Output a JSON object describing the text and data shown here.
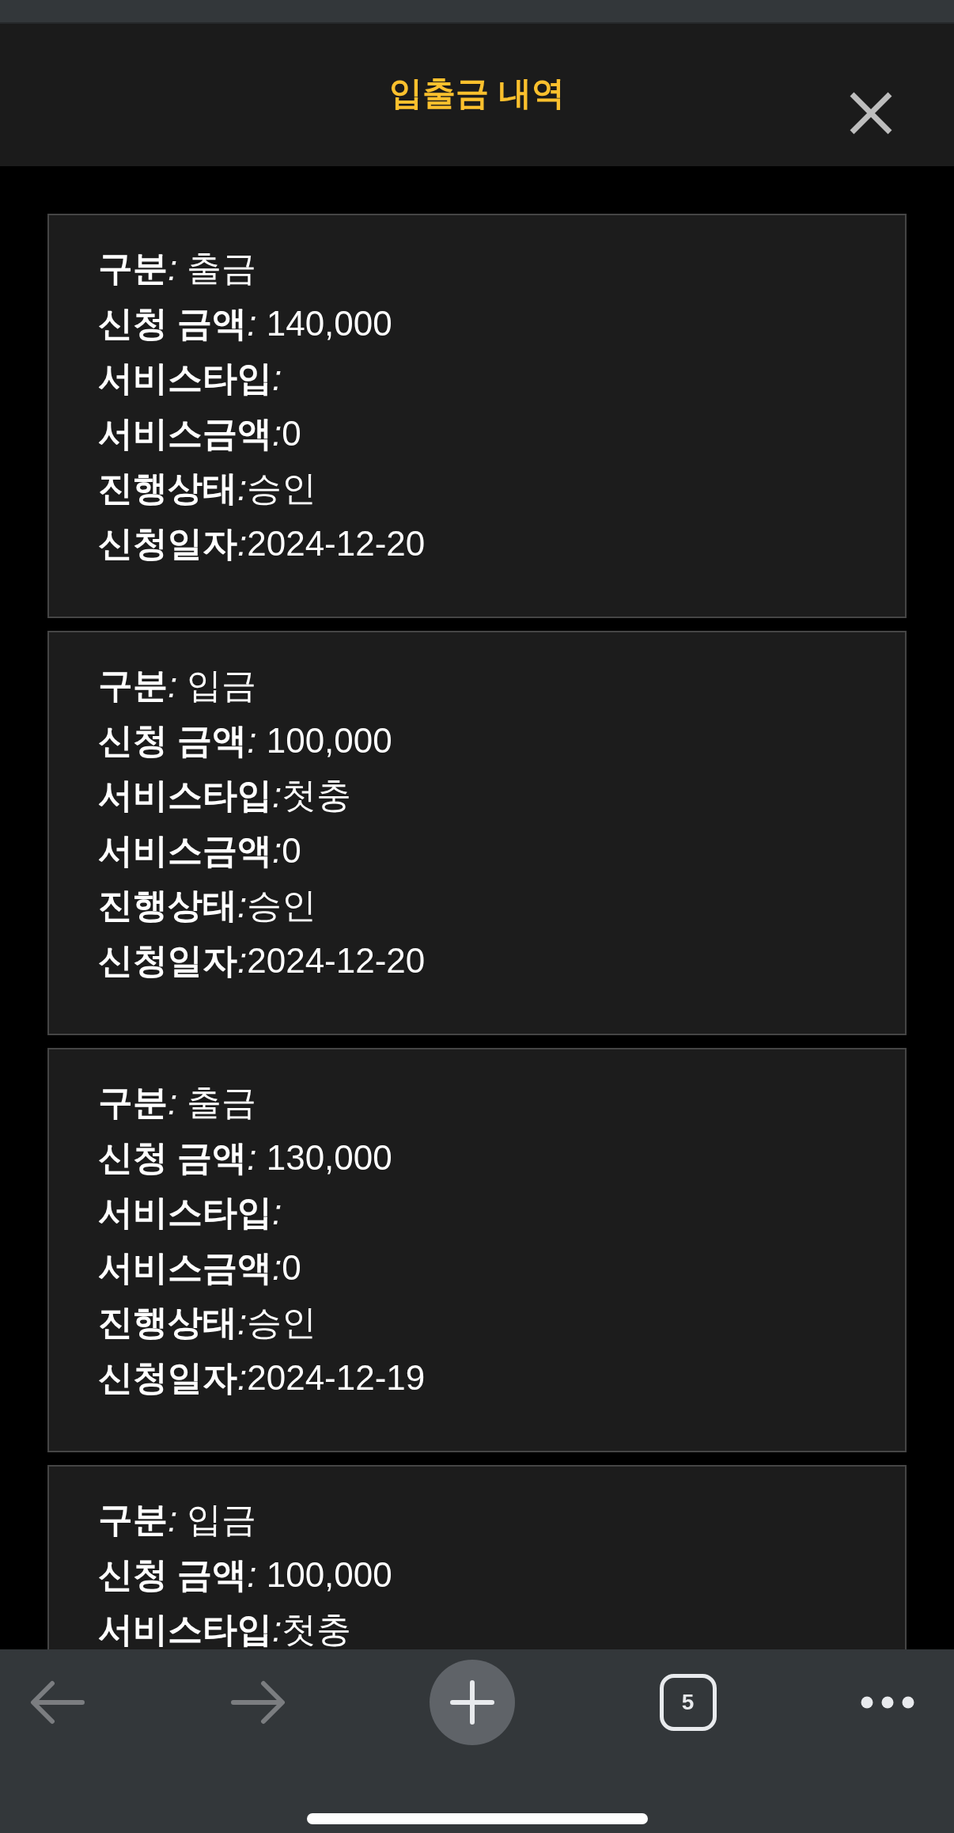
{
  "header": {
    "title": "입출금 내역"
  },
  "records": [
    {
      "lines": [
        {
          "label": "구분",
          "separator": ": ",
          "value": "출금"
        },
        {
          "label": "신청 금액",
          "separator": ": ",
          "value": "140,000"
        },
        {
          "label": "서비스타입",
          "separator": ":"
        },
        {
          "label": "서비스금액",
          "separator": ":",
          "value": "0"
        },
        {
          "label": "진행상태",
          "separator": ":",
          "value": "승인"
        },
        {
          "label": "신청일자",
          "separator": ":",
          "value": "2024-12-20"
        }
      ]
    },
    {
      "lines": [
        {
          "label": "구분",
          "separator": ": ",
          "value": "입금"
        },
        {
          "label": "신청 금액",
          "separator": ": ",
          "value": "100,000"
        },
        {
          "label": "서비스타입",
          "separator": ":",
          "value": "첫충"
        },
        {
          "label": "서비스금액",
          "separator": ":",
          "value": "0"
        },
        {
          "label": "진행상태",
          "separator": ":",
          "value": "승인"
        },
        {
          "label": "신청일자",
          "separator": ":",
          "value": "2024-12-20"
        }
      ]
    },
    {
      "lines": [
        {
          "label": "구분",
          "separator": ": ",
          "value": "출금"
        },
        {
          "label": "신청 금액",
          "separator": ": ",
          "value": "130,000"
        },
        {
          "label": "서비스타입",
          "separator": ":"
        },
        {
          "label": "서비스금액",
          "separator": ":",
          "value": "0"
        },
        {
          "label": "진행상태",
          "separator": ":",
          "value": "승인"
        },
        {
          "label": "신청일자",
          "separator": ":",
          "value": "2024-12-19"
        }
      ]
    },
    {
      "lines": [
        {
          "label": "구분",
          "separator": ": ",
          "value": "입금"
        },
        {
          "label": "신청 금액",
          "separator": ": ",
          "value": "100,000"
        },
        {
          "label": "서비스타입",
          "separator": ":",
          "value": "첫충"
        }
      ]
    }
  ],
  "toolbar": [
    {
      "kind": "back",
      "disabled": true
    },
    {
      "kind": "forward",
      "disabled": true
    },
    {
      "kind": "new_tab",
      "disabled": false
    },
    {
      "kind": "tabs",
      "label": "5",
      "disabled": false
    },
    {
      "kind": "menu",
      "disabled": false
    }
  ]
}
